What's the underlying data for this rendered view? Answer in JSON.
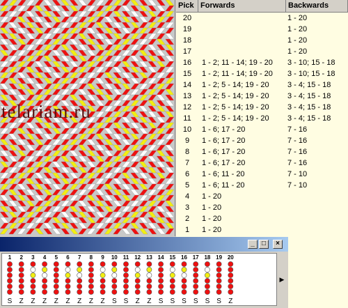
{
  "watermark": "telariam.ru",
  "colors": {
    "red": "#ee1010",
    "yellow": "#f2ee12",
    "white": "#ffffff",
    "table_bg": "#fffde2"
  },
  "table": {
    "headers": {
      "pick": "Pick",
      "forwards": "Forwards",
      "backwards": "Backwards"
    },
    "rows": [
      {
        "pick": "20",
        "fw": "",
        "bw": "1 - 20"
      },
      {
        "pick": "19",
        "fw": "",
        "bw": "1 - 20"
      },
      {
        "pick": "18",
        "fw": "",
        "bw": "1 - 20"
      },
      {
        "pick": "17",
        "fw": "",
        "bw": "1 - 20"
      },
      {
        "pick": "16",
        "fw": "1 - 2; 11 - 14; 19 - 20",
        "bw": "3 - 10; 15 - 18"
      },
      {
        "pick": "15",
        "fw": "1 - 2; 11 - 14; 19 - 20",
        "bw": "3 - 10; 15 - 18"
      },
      {
        "pick": "14",
        "fw": "1 - 2; 5 - 14; 19 - 20",
        "bw": "3 - 4; 15 - 18"
      },
      {
        "pick": "13",
        "fw": "1 - 2; 5 - 14; 19 - 20",
        "bw": "3 - 4; 15 - 18"
      },
      {
        "pick": "12",
        "fw": "1 - 2; 5 - 14; 19 - 20",
        "bw": "3 - 4; 15 - 18"
      },
      {
        "pick": "11",
        "fw": "1 - 2; 5 - 14; 19 - 20",
        "bw": "3 - 4; 15 - 18"
      },
      {
        "pick": "10",
        "fw": "1 - 6; 17 - 20",
        "bw": "7 - 16"
      },
      {
        "pick": "9",
        "fw": "1 - 6; 17 - 20",
        "bw": "7 - 16"
      },
      {
        "pick": "8",
        "fw": "1 - 6; 17 - 20",
        "bw": "7 - 16"
      },
      {
        "pick": "7",
        "fw": "1 - 6; 17 - 20",
        "bw": "7 - 16"
      },
      {
        "pick": "6",
        "fw": "1 - 6; 11 - 20",
        "bw": "7 - 10"
      },
      {
        "pick": "5",
        "fw": "1 - 6; 11 - 20",
        "bw": "7 - 10"
      },
      {
        "pick": "4",
        "fw": "1 - 20",
        "bw": ""
      },
      {
        "pick": "3",
        "fw": "1 - 20",
        "bw": ""
      },
      {
        "pick": "2",
        "fw": "1 - 20",
        "bw": ""
      },
      {
        "pick": "1",
        "fw": "1 - 20",
        "bw": ""
      }
    ]
  },
  "window_buttons": {
    "minimize": "_",
    "maximize": "□",
    "close": "×"
  },
  "scroll_arrow": "▶",
  "cards": {
    "numbers": [
      "1",
      "2",
      "3",
      "4",
      "5",
      "6",
      "7",
      "8",
      "9",
      "10",
      "11",
      "12",
      "13",
      "14",
      "15",
      "16",
      "17",
      "18",
      "19",
      "20"
    ],
    "threading": [
      "S",
      "Z",
      "Z",
      "Z",
      "Z",
      "Z",
      "Z",
      "Z",
      "Z",
      "S",
      "S",
      "Z",
      "Z",
      "S",
      "S",
      "S",
      "S",
      "S",
      "S",
      "Z"
    ],
    "holes": [
      [
        "red",
        "red",
        "red",
        "red",
        "red",
        "red"
      ],
      [
        "red",
        "red",
        "red",
        "red",
        "red",
        "red"
      ],
      [
        "red",
        "white",
        "yellow",
        "red",
        "red",
        "red"
      ],
      [
        "red",
        "yellow",
        "white",
        "red",
        "red",
        "red"
      ],
      [
        "red",
        "red",
        "red",
        "red",
        "red",
        "red"
      ],
      [
        "red",
        "white",
        "yellow",
        "red",
        "red",
        "red"
      ],
      [
        "red",
        "yellow",
        "white",
        "red",
        "red",
        "red"
      ],
      [
        "red",
        "red",
        "red",
        "red",
        "red",
        "red"
      ],
      [
        "red",
        "white",
        "yellow",
        "red",
        "red",
        "red"
      ],
      [
        "red",
        "yellow",
        "white",
        "red",
        "red",
        "red"
      ],
      [
        "red",
        "red",
        "red",
        "red",
        "red",
        "red"
      ],
      [
        "red",
        "white",
        "yellow",
        "red",
        "red",
        "red"
      ],
      [
        "red",
        "yellow",
        "white",
        "red",
        "red",
        "red"
      ],
      [
        "red",
        "red",
        "red",
        "red",
        "red",
        "red"
      ],
      [
        "red",
        "white",
        "yellow",
        "red",
        "red",
        "red"
      ],
      [
        "red",
        "yellow",
        "white",
        "red",
        "red",
        "red"
      ],
      [
        "red",
        "red",
        "red",
        "red",
        "red",
        "red"
      ],
      [
        "red",
        "white",
        "yellow",
        "red",
        "red",
        "red"
      ],
      [
        "red",
        "red",
        "red",
        "red",
        "red",
        "red"
      ],
      [
        "red",
        "red",
        "red",
        "red",
        "red",
        "red"
      ]
    ]
  }
}
